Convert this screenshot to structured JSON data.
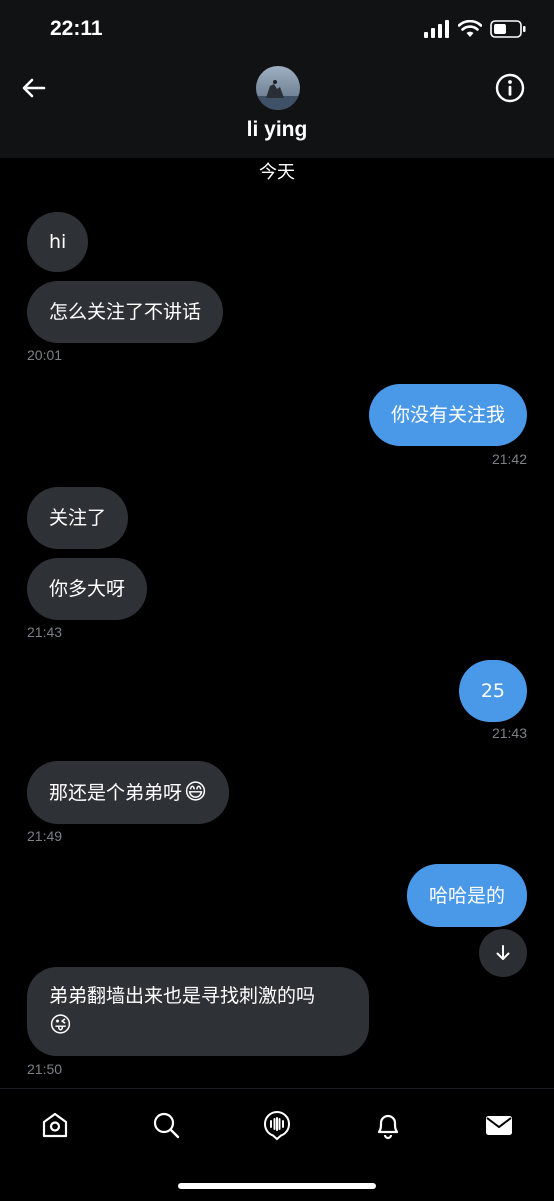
{
  "status": {
    "time": "22:11"
  },
  "header": {
    "contact_name": "li ying",
    "date_label": "今天"
  },
  "messages": [
    {
      "dir": "in",
      "text": "hi"
    },
    {
      "dir": "in",
      "text": "怎么关注了不讲话",
      "time": "20:01"
    },
    {
      "dir": "out",
      "text": "你没有关注我",
      "time": "21:42"
    },
    {
      "dir": "in",
      "text": "关注了"
    },
    {
      "dir": "in",
      "text": "你多大呀",
      "time": "21:43"
    },
    {
      "dir": "out",
      "text": "25",
      "time": "21:43"
    },
    {
      "dir": "in",
      "text": "那还是个弟弟呀",
      "emoji": "😄",
      "time": "21:49"
    },
    {
      "dir": "out",
      "text": "哈哈是的"
    },
    {
      "dir": "in",
      "text": "弟弟翻墙出来也是寻找刺激的吗",
      "emoji": "😜",
      "time": "21:50"
    }
  ],
  "icons": {
    "back": "arrow-left-icon",
    "info": "info-icon",
    "scroll_down": "arrow-down-icon",
    "tabs": [
      "home-icon",
      "search-icon",
      "spaces-icon",
      "bell-icon",
      "mail-icon"
    ]
  },
  "colors": {
    "outgoing_bubble": "#4a99e9",
    "incoming_bubble": "#2e3236",
    "background": "#000000"
  }
}
